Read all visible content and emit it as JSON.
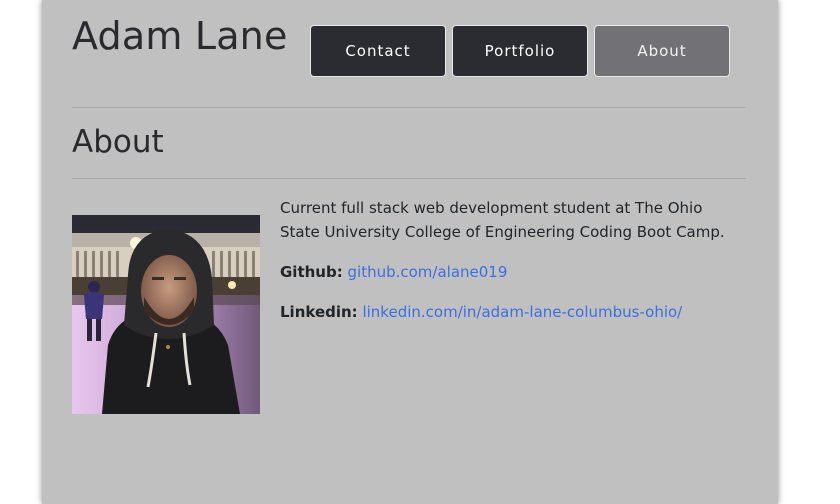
{
  "header": {
    "site_title": "Adam Lane",
    "nav": [
      {
        "label": "Contact",
        "active": false
      },
      {
        "label": "Portfolio",
        "active": false
      },
      {
        "label": "About",
        "active": true
      }
    ]
  },
  "about": {
    "title": "About",
    "bio": "Current full stack web development student at The Ohio State University College of Engineering Coding Boot Camp.",
    "github_label": "Github:",
    "github_link": "github.com/alane019",
    "linkedin_label": "Linkedin:",
    "linkedin_link": "linkedin.com/in/adam-lane-columbus-ohio/"
  },
  "colors": {
    "page_background": "#c0c0c0",
    "nav_button": "#2b2c31",
    "nav_button_active": "#717176",
    "link": "#3b6fe0"
  }
}
